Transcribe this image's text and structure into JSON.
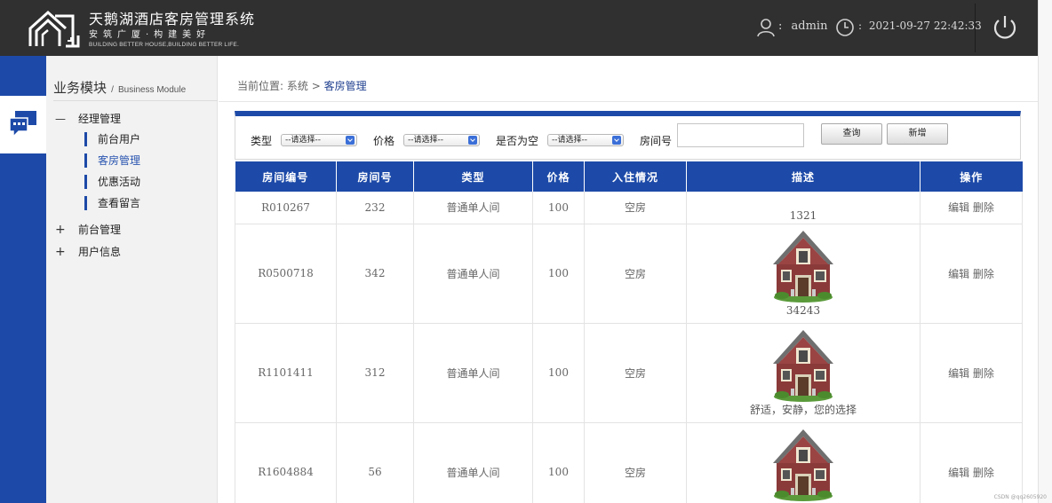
{
  "header": {
    "title": "天鹅湖酒店客房管理系统",
    "slogan": "安筑广厦·构建美好",
    "slogan_en": "BUILDING BETTER HOUSE,BUILDING BETTER LIFE.",
    "user_separator": ":",
    "username": "admin",
    "datetime_separator": ":",
    "datetime": "2021-09-27 22:42:33"
  },
  "sidebar": {
    "module_cn": "业务模块",
    "module_sep": "/",
    "module_en": "Business Module",
    "groups": [
      {
        "label": "经理管理",
        "sign": "—",
        "expanded": true
      },
      {
        "label": "前台管理",
        "sign": "+",
        "expanded": false
      },
      {
        "label": "用户信息",
        "sign": "+",
        "expanded": false
      }
    ],
    "items": [
      {
        "label": "前台用户"
      },
      {
        "label": "客房管理",
        "active": true
      },
      {
        "label": "优惠活动"
      },
      {
        "label": "查看留言"
      }
    ]
  },
  "breadcrumb": {
    "prefix": "当前位置:",
    "path": "系统",
    "separator": ">",
    "current": "客房管理"
  },
  "filters": {
    "type_label": "类型",
    "type_value": "--请选择--",
    "price_label": "价格",
    "price_value": "--请选择--",
    "vacant_label": "是否为空",
    "vacant_value": "--请选择--",
    "room_no_label": "房间号",
    "room_no_value": "",
    "search_button": "查询",
    "add_button": "新增"
  },
  "table": {
    "columns": [
      "房间编号",
      "房间号",
      "类型",
      "价格",
      "入住情况",
      "描述",
      "操作"
    ],
    "edit_label": "编辑",
    "delete_label": "删除",
    "rows": [
      {
        "id": "R010267",
        "room_no": "232",
        "type": "普通单人间",
        "price": "100",
        "status": "空房",
        "desc": "1321",
        "has_image": false
      },
      {
        "id": "R0500718",
        "room_no": "342",
        "type": "普通单人间",
        "price": "100",
        "status": "空房",
        "desc": "34243",
        "has_image": true
      },
      {
        "id": "R1101411",
        "room_no": "312",
        "type": "普通单人间",
        "price": "100",
        "status": "空房",
        "desc": "舒适，安静，您的选择",
        "has_image": true
      },
      {
        "id": "R1604884",
        "room_no": "56",
        "type": "普通单人间",
        "price": "100",
        "status": "空房",
        "desc": "",
        "has_image": true
      }
    ]
  },
  "watermark": "CSDN @qq2605920",
  "colors": {
    "header_bg": "#303030",
    "accent_blue": "#1d4aa8",
    "sidebar_bg": "#f2f2f2"
  }
}
